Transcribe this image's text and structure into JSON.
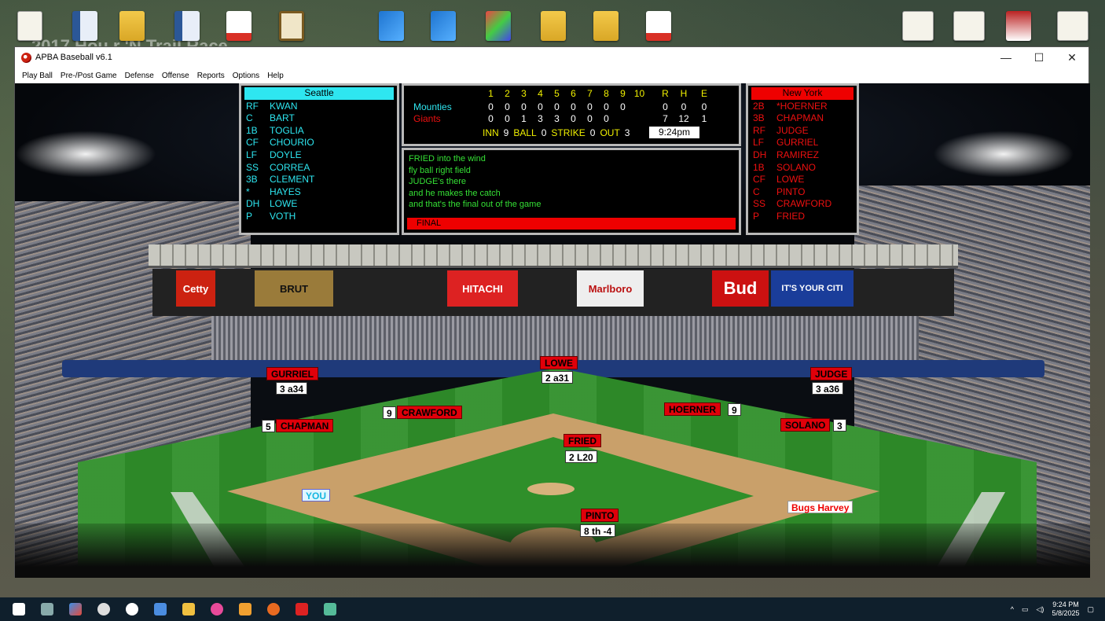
{
  "desktop": {
    "wallpaper_text": "2017 Hou r 'N Trail Race"
  },
  "window": {
    "title": "APBA Baseball v6.1",
    "controls": {
      "minimize": "—",
      "maximize": "☐",
      "close": "✕"
    }
  },
  "menu": {
    "items": [
      "Play Ball",
      "Pre-/Post Game",
      "Defense",
      "Offense",
      "Reports",
      "Options",
      "Help"
    ]
  },
  "away_lineup": {
    "team": "Seattle",
    "players": [
      {
        "pos": "RF",
        "name": "KWAN"
      },
      {
        "pos": "C",
        "name": "BART"
      },
      {
        "pos": "1B",
        "name": "TOGLIA"
      },
      {
        "pos": "CF",
        "name": "CHOURIO"
      },
      {
        "pos": "LF",
        "name": "DOYLE"
      },
      {
        "pos": "SS",
        "name": "CORREA"
      },
      {
        "pos": "3B",
        "name": "CLEMENT"
      },
      {
        "pos": "*",
        "name": "HAYES"
      },
      {
        "pos": "DH",
        "name": "LOWE"
      },
      {
        "pos": "P",
        "name": "VOTH"
      }
    ]
  },
  "home_lineup": {
    "team": "New York",
    "players": [
      {
        "pos": "2B",
        "name": "*HOERNER"
      },
      {
        "pos": "3B",
        "name": "CHAPMAN"
      },
      {
        "pos": "RF",
        "name": "JUDGE"
      },
      {
        "pos": "LF",
        "name": "GURRIEL"
      },
      {
        "pos": "DH",
        "name": "RAMIREZ"
      },
      {
        "pos": "1B",
        "name": "SOLANO"
      },
      {
        "pos": "CF",
        "name": "LOWE"
      },
      {
        "pos": "C",
        "name": "PINTO"
      },
      {
        "pos": "SS",
        "name": "CRAWFORD"
      },
      {
        "pos": "P",
        "name": "FRIED"
      }
    ]
  },
  "scoreboard": {
    "innings": [
      "1",
      "2",
      "3",
      "4",
      "5",
      "6",
      "7",
      "8",
      "9",
      "10"
    ],
    "totals_headers": [
      "R",
      "H",
      "E"
    ],
    "away": {
      "name": "Mounties",
      "innings": [
        "0",
        "0",
        "0",
        "0",
        "0",
        "0",
        "0",
        "0",
        "0",
        ""
      ],
      "totals": [
        "0",
        "0",
        "0"
      ]
    },
    "home": {
      "name": "Giants",
      "innings": [
        "0",
        "0",
        "1",
        "3",
        "3",
        "0",
        "0",
        "0",
        "",
        ""
      ],
      "totals": [
        "7",
        "12",
        "1"
      ]
    },
    "status": {
      "inn_label": "INN",
      "inn": "9",
      "ball_label": "BALL",
      "ball": "0",
      "strike_label": "STRIKE",
      "strike": "0",
      "out_label": "OUT",
      "out": "3"
    },
    "clock": "9:24pm"
  },
  "play_by_play": {
    "lines": [
      "FRIED into the wind",
      "fly ball right field",
      "JUDGE's there",
      "and he makes the catch",
      "and that's the final out of the game"
    ],
    "result": "FINAL"
  },
  "field": {
    "gurriel": {
      "name": "GURRIEL",
      "rating": "3 a34"
    },
    "lowe": {
      "name": "LOWE",
      "rating": "2 a31"
    },
    "judge": {
      "name": "JUDGE",
      "rating": "3 a36"
    },
    "crawford": {
      "name": "CRAWFORD",
      "num": "9"
    },
    "hoerner": {
      "name": "HOERNER",
      "num": "9"
    },
    "chapman": {
      "name": "CHAPMAN",
      "num": "5"
    },
    "solano": {
      "name": "SOLANO",
      "num": "3"
    },
    "fried": {
      "name": "FRIED",
      "rating": "2 L20"
    },
    "pinto": {
      "name": "PINTO",
      "rating": "8 th -4"
    },
    "you_label": "YOU",
    "manager": "Bugs Harvey"
  },
  "ads": [
    "Cetty",
    "BRUT",
    "HITACHI",
    "Marlboro",
    "Bud",
    "IT'S YOUR CITI"
  ],
  "taskbar": {
    "time": "9:24 PM",
    "date": "5/8/2025"
  }
}
